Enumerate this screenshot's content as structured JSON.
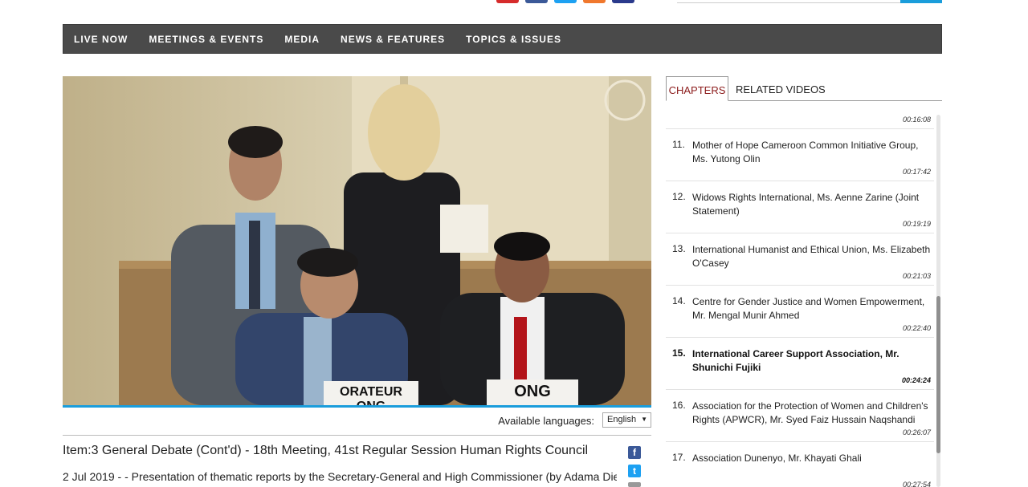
{
  "nav": {
    "items": [
      "LIVE NOW",
      "MEETINGS & EVENTS",
      "MEDIA",
      "NEWS & FEATURES",
      "TOPICS & ISSUES"
    ]
  },
  "video": {
    "placard_left": "ORATEUR ONG",
    "placard_right": "ONG"
  },
  "languages": {
    "label": "Available languages:",
    "selected": "English"
  },
  "meeting": {
    "title": "Item:3 General Debate (Cont'd) - 18th Meeting, 41st Regular Session Human Rights Council",
    "date": "2 Jul 2019 -",
    "description": "- Presentation of thematic reports by the Secretary-General and High Commissioner (by Adama Dieng,"
  },
  "tabs": {
    "chapters": "CHAPTERS",
    "related": "RELATED VIDEOS"
  },
  "chapters": {
    "first_time": "00:16:08",
    "items": [
      {
        "num": "11.",
        "text": "Mother of Hope Cameroon Common Initiative Group, Ms. Yutong Olin",
        "time": "00:17:42"
      },
      {
        "num": "12.",
        "text": "Widows Rights International, Ms. Aenne Zarine (Joint Statement)",
        "time": "00:19:19"
      },
      {
        "num": "13.",
        "text": "International Humanist and Ethical Union, Ms. Elizabeth O'Casey",
        "time": "00:21:03"
      },
      {
        "num": "14.",
        "text": "Centre for Gender Justice and Women Empowerment, Mr. Mengal Munir Ahmed",
        "time": "00:22:40"
      },
      {
        "num": "15.",
        "text": "International Career Support Association, Mr. Shunichi Fujiki",
        "time": "00:24:24"
      },
      {
        "num": "16.",
        "text": "Association for the Protection of Women and Children's Rights (APWCR), Mr. Syed Faiz Hussain Naqshandi",
        "time": "00:26:07"
      },
      {
        "num": "17.",
        "text": "Association Dunenyo, Mr. Khayati Ghali",
        "time": "00:27:54"
      }
    ]
  },
  "colors": {
    "accent": "#1a9ddb",
    "nav_bg": "#4a4a4a",
    "active_tab": "#8b1a1a"
  }
}
